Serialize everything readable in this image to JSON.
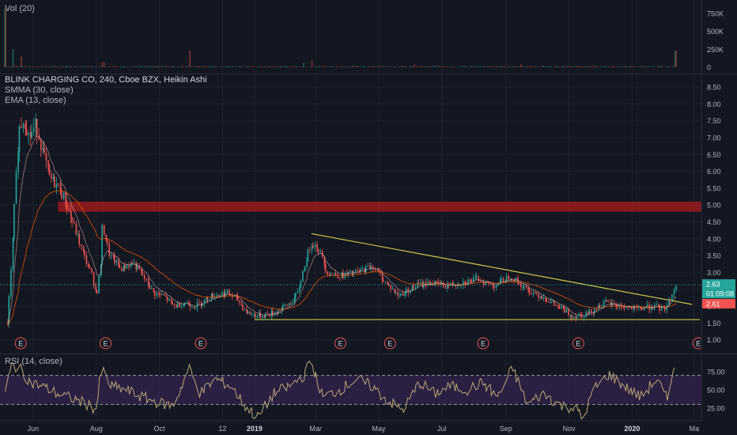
{
  "panes": {
    "volume": {
      "legend": "Vol (20)",
      "ticks": [
        {
          "label": "750K",
          "v": 750
        },
        {
          "label": "500K",
          "v": 500
        },
        {
          "label": "250K",
          "v": 250
        },
        {
          "label": "0",
          "v": 0
        }
      ]
    },
    "price": {
      "legend_lines": [
        "BLINK CHARGING CO, 240, Cboe BZX, Heikin Ashi",
        "SMMA (30, close)",
        "EMA (13, close)"
      ],
      "ticks": [
        "8.50",
        "8.00",
        "7.50",
        "7.00",
        "6.50",
        "6.00",
        "5.50",
        "5.00",
        "4.50",
        "4.00",
        "3.50",
        "3.00",
        "2.50",
        "2.00",
        "1.50",
        "1.00"
      ],
      "price_tags": [
        {
          "text": "2.63",
          "color": "#26a69a"
        },
        {
          "text": "01:09:08",
          "color": "#26a69a"
        },
        {
          "text": "2.61",
          "color": "#ef5350"
        }
      ],
      "earnings_marker_label": "E"
    },
    "rsi": {
      "legend": "RSI (14, close)",
      "ticks": [
        "75.00",
        "50.00",
        "25.00"
      ]
    }
  },
  "x_axis": [
    "Jun",
    "Aug",
    "Oct",
    "12",
    "2019",
    "Mar",
    "May",
    "Jul",
    "Sep",
    "Nov",
    "2020",
    "Ma"
  ],
  "colors": {
    "background": "#131722",
    "up": "#26a69a",
    "down": "#ef5350",
    "smma": "#e65100",
    "ema": "#f0c0c0",
    "trendline": "#c9c94a",
    "zone": "#b71c1c",
    "rsi": "#b8a878",
    "rsi_band": "#4a2a6a"
  },
  "chart_data": [
    {
      "type": "candlestick",
      "title": "BLINK CHARGING CO, 240, Cboe BZX, Heikin Ashi",
      "ylim": [
        0.8,
        8.8
      ],
      "close_path": [
        {
          "x": "2018-05-07",
          "y": 1.5
        },
        {
          "x": "2018-05-10",
          "y": 2.8
        },
        {
          "x": "2018-05-14",
          "y": 5.0
        },
        {
          "x": "2018-05-18",
          "y": 7.2
        },
        {
          "x": "2018-05-23",
          "y": 7.6
        },
        {
          "x": "2018-05-28",
          "y": 7.0
        },
        {
          "x": "2018-06-04",
          "y": 7.4
        },
        {
          "x": "2018-06-10",
          "y": 6.6
        },
        {
          "x": "2018-06-17",
          "y": 5.8
        },
        {
          "x": "2018-06-24",
          "y": 5.6
        },
        {
          "x": "2018-07-01",
          "y": 5.2
        },
        {
          "x": "2018-07-10",
          "y": 4.4
        },
        {
          "x": "2018-07-20",
          "y": 3.5
        },
        {
          "x": "2018-07-28",
          "y": 2.9
        },
        {
          "x": "2018-08-01",
          "y": 2.3
        },
        {
          "x": "2018-08-05",
          "y": 3.2
        },
        {
          "x": "2018-08-07",
          "y": 4.4
        },
        {
          "x": "2018-08-14",
          "y": 3.5
        },
        {
          "x": "2018-08-25",
          "y": 3.1
        },
        {
          "x": "2018-09-05",
          "y": 3.3
        },
        {
          "x": "2018-09-15",
          "y": 2.9
        },
        {
          "x": "2018-09-25",
          "y": 2.4
        },
        {
          "x": "2018-10-05",
          "y": 2.3
        },
        {
          "x": "2018-10-15",
          "y": 2.0
        },
        {
          "x": "2018-10-25",
          "y": 2.1
        },
        {
          "x": "2018-11-05",
          "y": 2.0
        },
        {
          "x": "2018-11-20",
          "y": 2.3
        },
        {
          "x": "2018-12-05",
          "y": 2.4
        },
        {
          "x": "2018-12-15",
          "y": 2.2
        },
        {
          "x": "2018-12-25",
          "y": 1.8
        },
        {
          "x": "2019-01-05",
          "y": 1.7
        },
        {
          "x": "2019-01-20",
          "y": 1.8
        },
        {
          "x": "2019-02-05",
          "y": 2.1
        },
        {
          "x": "2019-02-12",
          "y": 2.4
        },
        {
          "x": "2019-02-18",
          "y": 3.2
        },
        {
          "x": "2019-02-25",
          "y": 3.9
        },
        {
          "x": "2019-03-04",
          "y": 3.7
        },
        {
          "x": "2019-03-12",
          "y": 3.0
        },
        {
          "x": "2019-03-25",
          "y": 2.9
        },
        {
          "x": "2019-04-10",
          "y": 3.0
        },
        {
          "x": "2019-04-25",
          "y": 3.2
        },
        {
          "x": "2019-05-05",
          "y": 2.8
        },
        {
          "x": "2019-05-20",
          "y": 2.3
        },
        {
          "x": "2019-06-05",
          "y": 2.6
        },
        {
          "x": "2019-06-20",
          "y": 2.7
        },
        {
          "x": "2019-07-05",
          "y": 2.6
        },
        {
          "x": "2019-07-20",
          "y": 2.7
        },
        {
          "x": "2019-08-05",
          "y": 2.8
        },
        {
          "x": "2019-08-20",
          "y": 2.6
        },
        {
          "x": "2019-09-05",
          "y": 2.9
        },
        {
          "x": "2019-09-20",
          "y": 2.5
        },
        {
          "x": "2019-10-05",
          "y": 2.3
        },
        {
          "x": "2019-10-20",
          "y": 2.0
        },
        {
          "x": "2019-11-05",
          "y": 1.7
        },
        {
          "x": "2019-11-20",
          "y": 1.8
        },
        {
          "x": "2019-12-05",
          "y": 2.1
        },
        {
          "x": "2019-12-20",
          "y": 2.0
        },
        {
          "x": "2020-01-05",
          "y": 1.9
        },
        {
          "x": "2020-01-20",
          "y": 2.0
        },
        {
          "x": "2020-02-01",
          "y": 1.9
        },
        {
          "x": "2020-02-08",
          "y": 2.3
        },
        {
          "x": "2020-02-12",
          "y": 2.63
        }
      ],
      "resistance_zone": [
        4.8,
        5.1
      ],
      "support_line": 1.6,
      "descending_trendline": [
        {
          "x": "2019-02-25",
          "y": 4.15
        },
        {
          "x": "2020-02-28",
          "y": 2.05
        }
      ],
      "earnings_dates": [
        "2018-05-20",
        "2018-08-10",
        "2018-11-10",
        "2019-03-25",
        "2019-05-12",
        "2019-08-10",
        "2019-11-10",
        "2020-03-05"
      ],
      "last_price": 2.63,
      "countdown": "01:09:08",
      "tag_price": 2.61
    },
    {
      "type": "bar",
      "title": "Vol (20)",
      "ylim": [
        0,
        850
      ],
      "unit": "thousands",
      "spikes": [
        {
          "x": "2018-05-05",
          "y": 820
        },
        {
          "x": "2018-05-12",
          "y": 250
        },
        {
          "x": "2018-05-20",
          "y": 150
        },
        {
          "x": "2018-08-07",
          "y": 70
        },
        {
          "x": "2018-10-30",
          "y": 230
        },
        {
          "x": "2019-02-18",
          "y": 60
        },
        {
          "x": "2019-02-26",
          "y": 90
        },
        {
          "x": "2019-06-05",
          "y": 40
        },
        {
          "x": "2019-09-15",
          "y": 40
        },
        {
          "x": "2020-02-12",
          "y": 230
        }
      ]
    },
    {
      "type": "line",
      "title": "RSI (14, close)",
      "ylim": [
        0,
        100
      ],
      "overbought": 70,
      "oversold": 30,
      "path": [
        {
          "x": "2018-05-05",
          "y": 45
        },
        {
          "x": "2018-05-12",
          "y": 85
        },
        {
          "x": "2018-05-20",
          "y": 78
        },
        {
          "x": "2018-05-30",
          "y": 60
        },
        {
          "x": "2018-06-10",
          "y": 55
        },
        {
          "x": "2018-06-25",
          "y": 45
        },
        {
          "x": "2018-07-10",
          "y": 38
        },
        {
          "x": "2018-07-25",
          "y": 30
        },
        {
          "x": "2018-08-01",
          "y": 22
        },
        {
          "x": "2018-08-07",
          "y": 80
        },
        {
          "x": "2018-08-15",
          "y": 55
        },
        {
          "x": "2018-08-30",
          "y": 50
        },
        {
          "x": "2018-09-15",
          "y": 40
        },
        {
          "x": "2018-10-01",
          "y": 32
        },
        {
          "x": "2018-10-15",
          "y": 28
        },
        {
          "x": "2018-10-30",
          "y": 80
        },
        {
          "x": "2018-11-10",
          "y": 45
        },
        {
          "x": "2018-11-25",
          "y": 65
        },
        {
          "x": "2018-12-10",
          "y": 55
        },
        {
          "x": "2018-12-25",
          "y": 25
        },
        {
          "x": "2019-01-05",
          "y": 12
        },
        {
          "x": "2019-01-20",
          "y": 45
        },
        {
          "x": "2019-02-05",
          "y": 55
        },
        {
          "x": "2019-02-18",
          "y": 70
        },
        {
          "x": "2019-02-25",
          "y": 90
        },
        {
          "x": "2019-03-08",
          "y": 40
        },
        {
          "x": "2019-03-25",
          "y": 50
        },
        {
          "x": "2019-04-10",
          "y": 65
        },
        {
          "x": "2019-04-25",
          "y": 55
        },
        {
          "x": "2019-05-10",
          "y": 35
        },
        {
          "x": "2019-05-25",
          "y": 22
        },
        {
          "x": "2019-06-10",
          "y": 60
        },
        {
          "x": "2019-06-25",
          "y": 45
        },
        {
          "x": "2019-07-10",
          "y": 55
        },
        {
          "x": "2019-07-25",
          "y": 50
        },
        {
          "x": "2019-08-10",
          "y": 60
        },
        {
          "x": "2019-08-25",
          "y": 40
        },
        {
          "x": "2019-09-08",
          "y": 80
        },
        {
          "x": "2019-09-22",
          "y": 30
        },
        {
          "x": "2019-10-08",
          "y": 45
        },
        {
          "x": "2019-10-25",
          "y": 28
        },
        {
          "x": "2019-11-08",
          "y": 25
        },
        {
          "x": "2019-11-15",
          "y": 10
        },
        {
          "x": "2019-11-25",
          "y": 50
        },
        {
          "x": "2019-12-10",
          "y": 72
        },
        {
          "x": "2019-12-25",
          "y": 55
        },
        {
          "x": "2020-01-10",
          "y": 40
        },
        {
          "x": "2020-01-25",
          "y": 65
        },
        {
          "x": "2020-02-05",
          "y": 35
        },
        {
          "x": "2020-02-10",
          "y": 85
        },
        {
          "x": "2020-02-12",
          "y": 80
        }
      ]
    }
  ]
}
